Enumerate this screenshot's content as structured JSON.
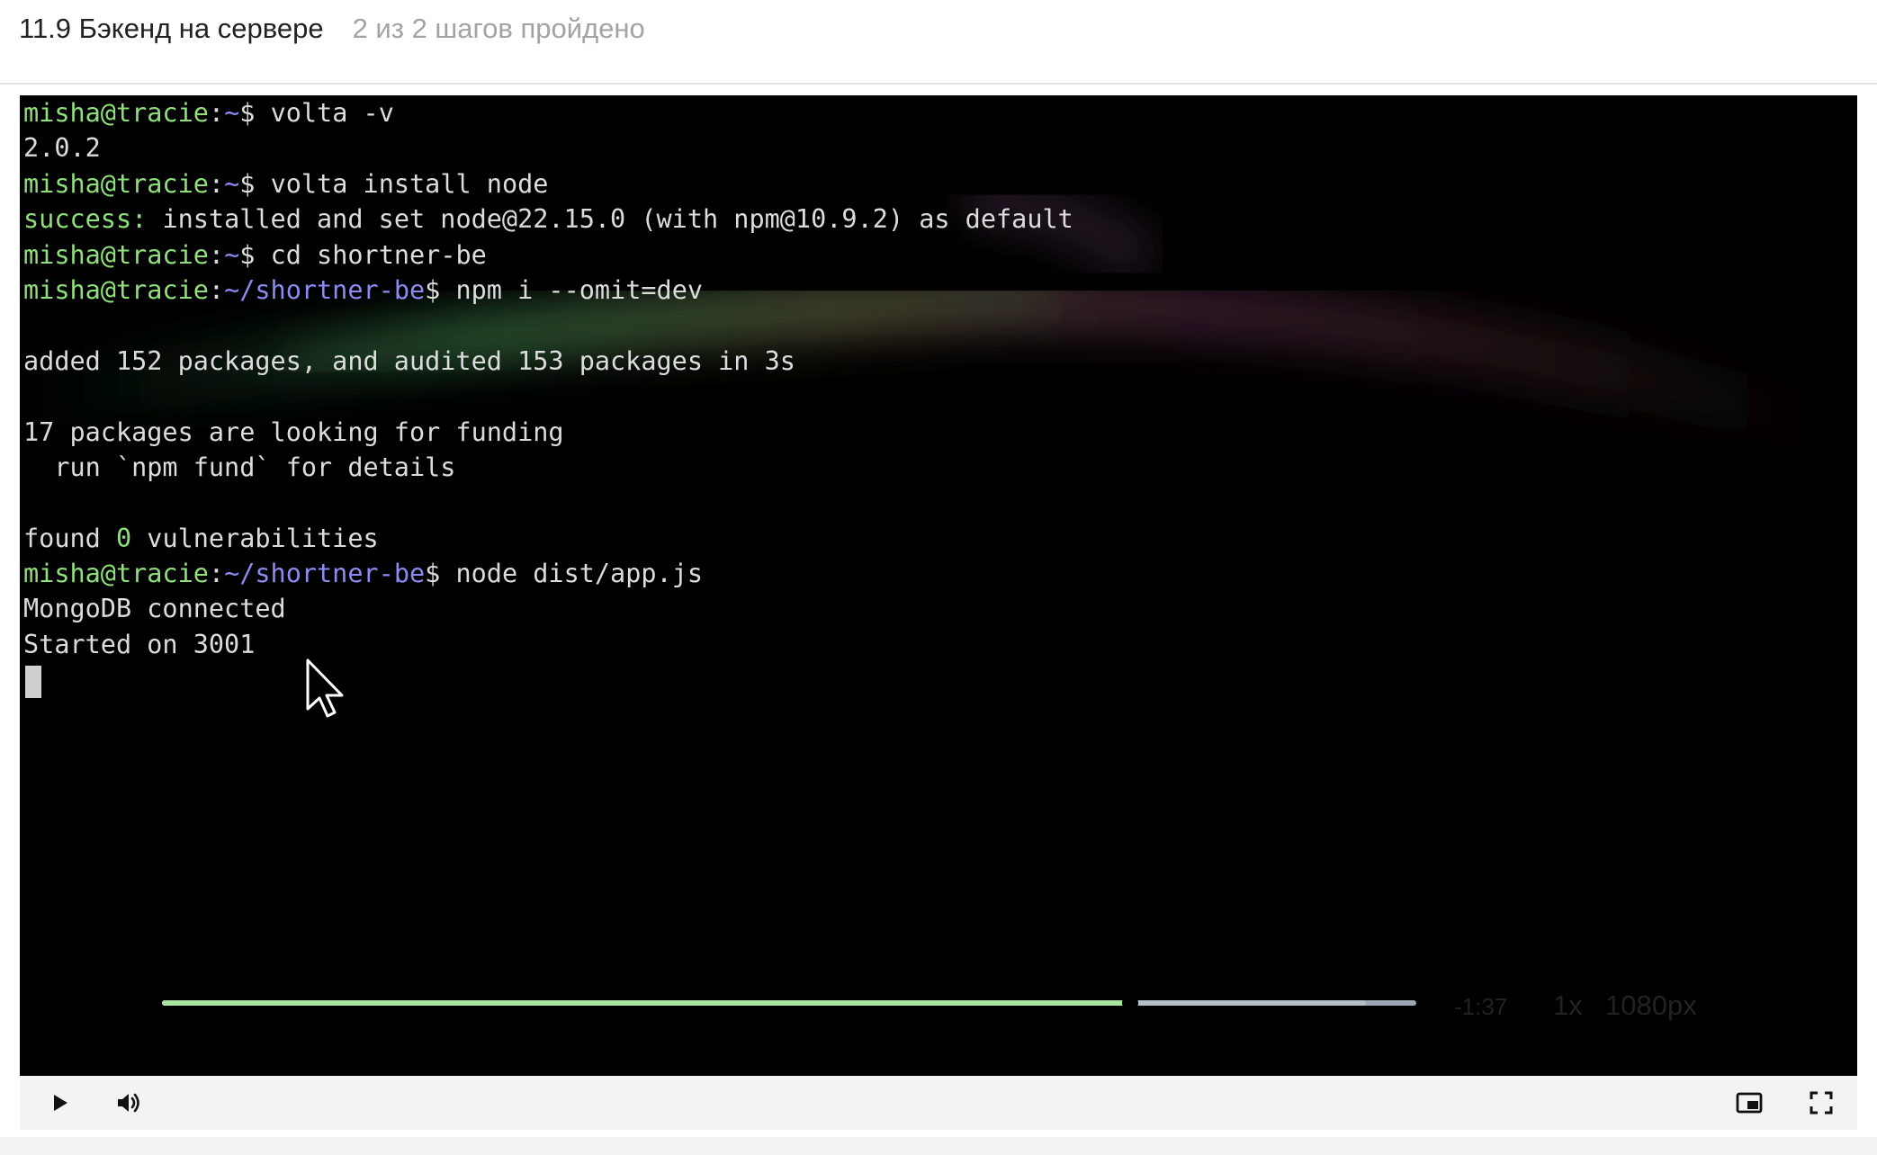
{
  "header": {
    "step_title": "11.9 Бэкенд на сервере",
    "step_progress": "2 из 2 шагов пройдено"
  },
  "terminal": {
    "lines": [
      {
        "user": "misha@tracie",
        "path": "~",
        "cmd": " volta -v"
      },
      {
        "text": "2.0.2"
      },
      {
        "user": "misha@tracie",
        "path": "~",
        "cmd": " volta install node"
      },
      {
        "success_label": "success:",
        "text": " installed and set node@22.15.0 (with npm@10.9.2) as default"
      },
      {
        "user": "misha@tracie",
        "path": "~",
        "cmd": " cd shortner-be"
      },
      {
        "user": "misha@tracie",
        "path": "~/shortner-be",
        "cmd": " npm i --omit=dev"
      },
      {
        "text": ""
      },
      {
        "text": "added 152 packages, and audited 153 packages in 3s"
      },
      {
        "text": ""
      },
      {
        "text": "17 packages are looking for funding"
      },
      {
        "text": "  run `npm fund` for details"
      },
      {
        "text": ""
      },
      {
        "found_prefix": "found ",
        "found_count": "0",
        "found_suffix": " vulnerabilities"
      },
      {
        "user": "misha@tracie",
        "path": "~/shortner-be",
        "cmd": " node dist/app.js"
      },
      {
        "text": "MongoDB connected"
      },
      {
        "text": "Started on 3001"
      }
    ]
  },
  "player": {
    "play_icon": "play-icon",
    "volume_icon": "volume-icon",
    "progress_played_fraction": 0.772,
    "progress_buffered_fraction": 0.96,
    "time_remaining": "-1:37",
    "speed": "1x",
    "quality": "1080px",
    "pip_icon": "picture-in-picture-icon",
    "fullscreen_icon": "fullscreen-icon"
  },
  "colors": {
    "prompt_user": "#8fe07a",
    "prompt_path": "#8c8cf0",
    "progress_played": "#a9e3a0",
    "progress_track": "#9da7b3"
  }
}
